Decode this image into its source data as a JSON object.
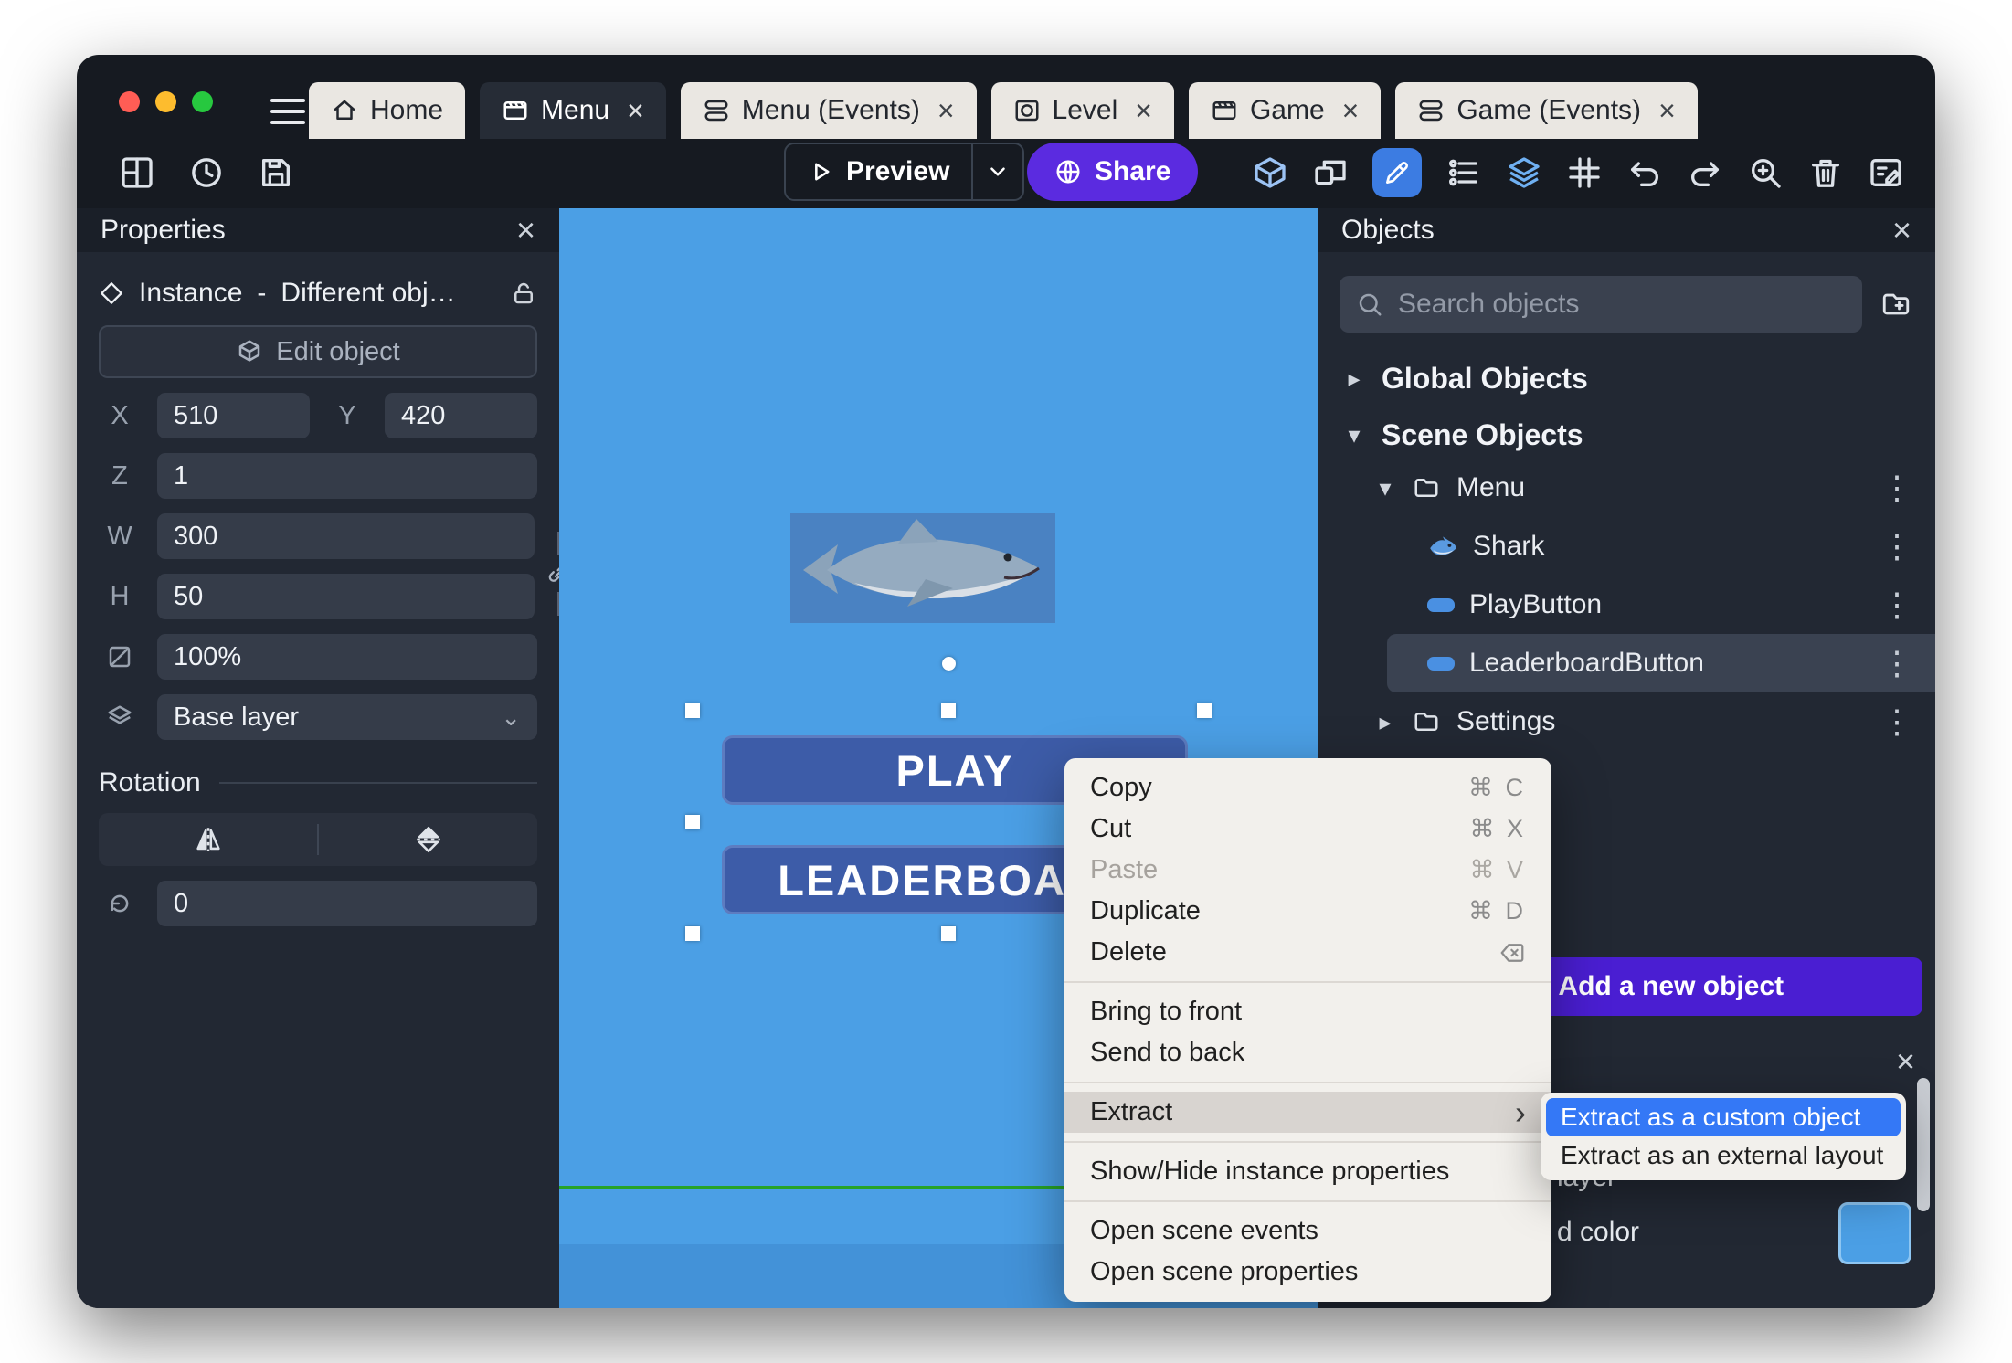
{
  "ui": {
    "close_glyph": "×",
    "kebab_glyph": "⋮",
    "tri_right": "▸",
    "tri_down": "▾",
    "chevron_down": "⌄",
    "submenu_arrow": "›",
    "plus_glyph": "+"
  },
  "tabs": [
    {
      "label": "Home"
    },
    {
      "label": "Menu"
    },
    {
      "label": "Menu (Events)"
    },
    {
      "label": "Level"
    },
    {
      "label": "Game"
    },
    {
      "label": "Game (Events)"
    }
  ],
  "toolbar": {
    "preview_label": "Preview",
    "share_label": "Share"
  },
  "properties": {
    "title": "Properties",
    "instance_type": "Instance",
    "separator": "-",
    "instance_name": "Different obj…",
    "edit_object_label": "Edit object",
    "x_label": "X",
    "x_value": "510",
    "y_label": "Y",
    "y_value": "420",
    "z_label": "Z",
    "z_value": "1",
    "w_label": "W",
    "w_value": "300",
    "h_label": "H",
    "h_value": "50",
    "opacity_value": "100%",
    "layer_value": "Base layer",
    "rotation_title": "Rotation",
    "angle_value": "0"
  },
  "canvas": {
    "play_label": "PLAY",
    "leaderboard_label": "LEADERBOARD"
  },
  "objects": {
    "title": "Objects",
    "search_placeholder": "Search objects",
    "groups": [
      {
        "label": "Global Objects"
      },
      {
        "label": "Scene Objects"
      }
    ],
    "tree": [
      {
        "label": "Menu"
      },
      {
        "label": "Shark"
      },
      {
        "label": "PlayButton"
      },
      {
        "label": "LeaderboardButton"
      },
      {
        "label": "Settings"
      }
    ],
    "add_button_label": "Add a new object"
  },
  "bottom_panel": {
    "layer_fragment": "layer",
    "color_fragment": "d color"
  },
  "context_menu": {
    "items": [
      {
        "label": "Copy",
        "shortcut": "⌘ C"
      },
      {
        "label": "Cut",
        "shortcut": "⌘ X"
      },
      {
        "label": "Paste",
        "shortcut": "⌘ V"
      },
      {
        "label": "Duplicate",
        "shortcut": "⌘ D"
      },
      {
        "label": "Delete",
        "shortcut": ""
      },
      {
        "label": "Bring to front",
        "shortcut": ""
      },
      {
        "label": "Send to back",
        "shortcut": ""
      },
      {
        "label": "Extract",
        "shortcut": ""
      },
      {
        "label": "Show/Hide instance properties",
        "shortcut": ""
      },
      {
        "label": "Open scene events",
        "shortcut": ""
      },
      {
        "label": "Open scene properties",
        "shortcut": ""
      }
    ]
  },
  "submenu": {
    "items": [
      {
        "label": "Extract as a custom object"
      },
      {
        "label": "Extract as an external layout"
      }
    ]
  },
  "colors": {
    "canvas_blue": "#4b9fe5",
    "accent_purple": "#5b2be0",
    "add_button_purple": "#4a1ed2",
    "selection_highlight": "#3478f6",
    "game_button_blue": "#3d5ca8"
  }
}
